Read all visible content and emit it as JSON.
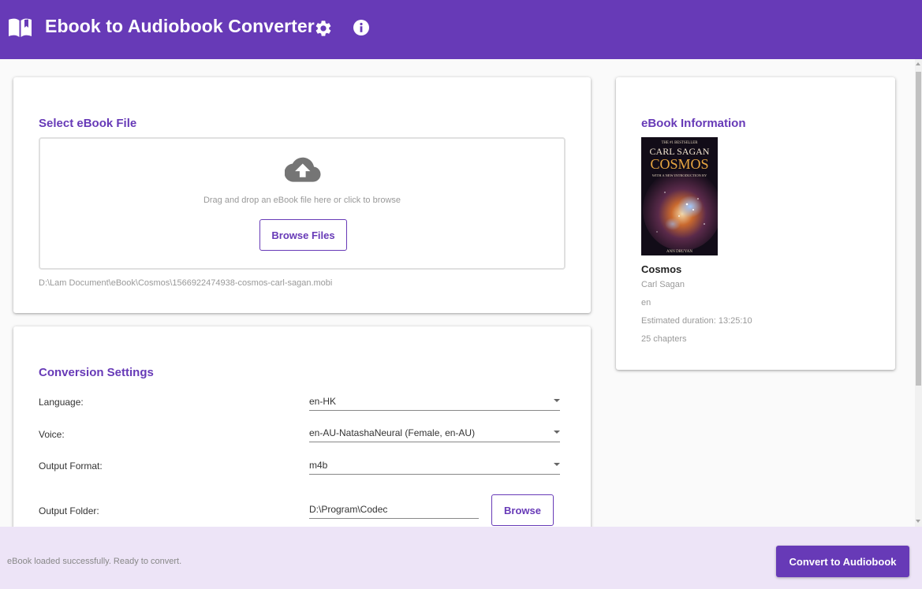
{
  "header": {
    "title": "Ebook to Audiobook Converter",
    "icons": [
      "book-open-icon",
      "gear-icon",
      "info-icon"
    ],
    "background_color": "#673ab7"
  },
  "file_section": {
    "title": "Select eBook File",
    "drop_text": "Drag and drop an eBook file here or click to browse",
    "browse_label": "Browse Files",
    "file_path": "D:\\Lam Document\\eBook\\Cosmos\\1566922474938-cosmos-carl-sagan.mobi",
    "upload_icon": "cloud-upload-icon"
  },
  "settings": {
    "title": "Conversion Settings",
    "language_label": "Language:",
    "language_value": "en-HK",
    "voice_label": "Voice:",
    "voice_value": "en-AU-NatashaNeural (Female, en-AU)",
    "format_label": "Output Format:",
    "format_value": "m4b",
    "folder_label": "Output Folder:",
    "folder_value": "D:\\Program\\Codec",
    "browse_label": "Browse"
  },
  "info": {
    "title": "eBook Information",
    "cover": {
      "top_text": "THE #1 BESTSELLER",
      "author": "CARL SAGAN",
      "title": "COSMOS",
      "subtitle": "WITH A NEW INTRODUCTION BY",
      "bottom_text": "ANN DRUYAN"
    },
    "book_title": "Cosmos",
    "author": "Carl Sagan",
    "language": "en",
    "duration": "Estimated duration: 13:25:10",
    "chapters": "25 chapters"
  },
  "footer": {
    "status": "eBook loaded successfully. Ready to convert.",
    "convert_label": "Convert to Audiobook"
  },
  "colors": {
    "accent": "#673ab7",
    "footer_background": "#ede4f7"
  }
}
